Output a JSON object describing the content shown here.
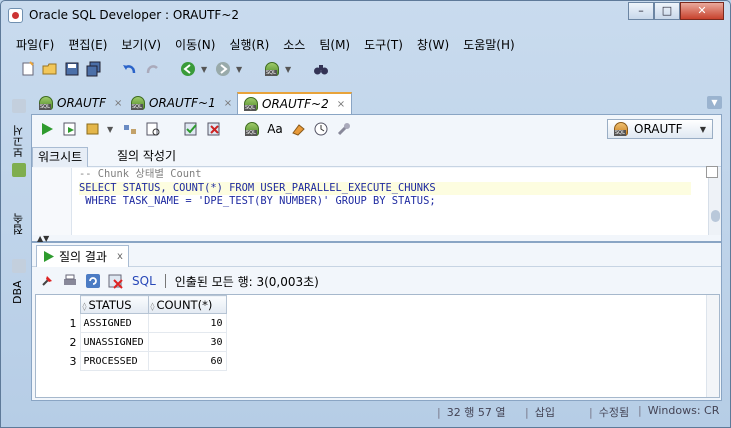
{
  "window": {
    "title": "Oracle SQL Developer : ORAUTF~2",
    "buttons": [
      "–",
      "□",
      "✕"
    ]
  },
  "menu": [
    "파일(F)",
    "편집(E)",
    "보기(V)",
    "이동(N)",
    "실행(R)",
    "소스",
    "팀(M)",
    "도구(T)",
    "창(W)",
    "도움말(H)"
  ],
  "left_dock": {
    "tabs": [
      "보고서",
      "접속",
      "DBA"
    ]
  },
  "doc_tabs": [
    {
      "label": "ORAUTF",
      "close": "×"
    },
    {
      "label": "ORAUTF~1",
      "close": "×"
    },
    {
      "label": "ORAUTF~2",
      "close": "×"
    }
  ],
  "connection": {
    "selected": "ORAUTF"
  },
  "editor_subtabs": [
    "워크시트",
    "질의 작성기"
  ],
  "code_lines": [
    "-- Chunk 상태별 Count",
    "SELECT STATUS, COUNT(*) FROM USER_PARALLEL_EXECUTE_CHUNKS",
    " WHERE TASK_NAME = 'DPE_TEST(BY NUMBER)' GROUP BY STATUS;"
  ],
  "results": {
    "tab_label": "질의 결과",
    "tab_close": "x",
    "sql_link": "SQL",
    "fetched_text": "인출된 모든 행: 3(0,003초)",
    "columns": [
      "STATUS",
      "COUNT(*)"
    ],
    "rows": [
      {
        "n": "1",
        "status": "ASSIGNED",
        "count": "10"
      },
      {
        "n": "2",
        "status": "UNASSIGNED",
        "count": "30"
      },
      {
        "n": "3",
        "status": "PROCESSED",
        "count": "60"
      }
    ]
  },
  "status_bar": {
    "position": "32 행 57 열",
    "mode": "삽입",
    "state": "수정됨",
    "eol": "Windows: CR"
  },
  "colors": {
    "title_bg": "#c9dbee",
    "active_tab_accent": "#e8a33a",
    "sql_link": "#2848b8",
    "keyword": "#1e2aa0"
  }
}
